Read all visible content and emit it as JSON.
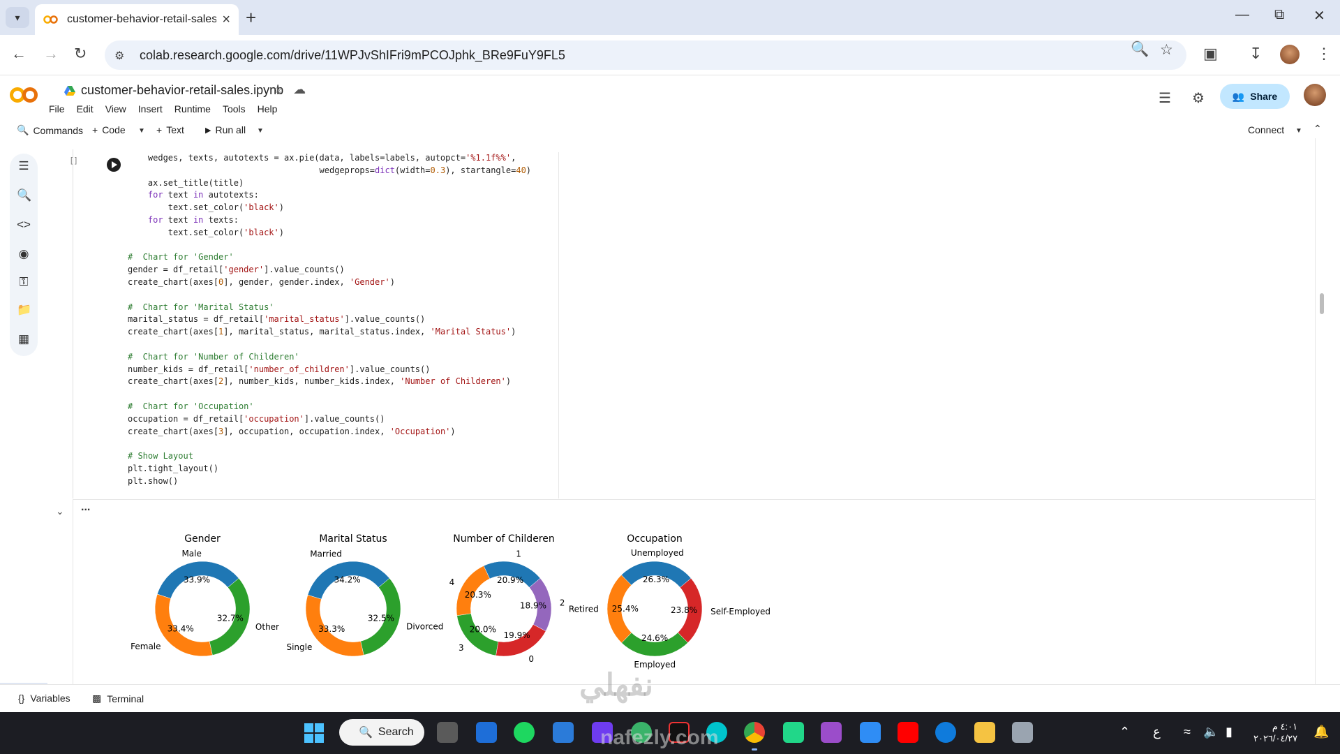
{
  "browser": {
    "tab_title": "customer-behavior-retail-sales.",
    "url": "colab.research.google.com/drive/11WPJvShIFri9mPCOJphk_BRe9FuY9FL5"
  },
  "colab": {
    "notebook_title": "customer-behavior-retail-sales.ipynb",
    "menu": [
      "File",
      "Edit",
      "View",
      "Insert",
      "Runtime",
      "Tools",
      "Help"
    ],
    "share_label": "Share",
    "toolbar": {
      "commands": "Commands",
      "code": "Code",
      "text": "Text",
      "run_all": "Run all",
      "connect": "Connect"
    }
  },
  "cell": {
    "bracket": "[ ]",
    "code_lines": [
      [
        [
          "",
          "    wedges, texts, autotexts = ax.pie(data, labels=labels, autopct="
        ],
        [
          "str",
          "'%1.1f%%'"
        ],
        [
          "",
          ","
        ]
      ],
      [
        [
          "",
          "                                      wedgeprops="
        ],
        [
          "kw",
          "dict"
        ],
        [
          "",
          "(width="
        ],
        [
          "num",
          "0.3"
        ],
        [
          "",
          "), startangle="
        ],
        [
          "num",
          "40"
        ],
        [
          "",
          ")"
        ]
      ],
      [
        [
          "",
          "    ax.set_title(title)"
        ]
      ],
      [
        [
          "kw",
          "    for"
        ],
        [
          "",
          " text "
        ],
        [
          "kw",
          "in"
        ],
        [
          "",
          " autotexts:"
        ]
      ],
      [
        [
          "",
          "        text.set_color("
        ],
        [
          "str",
          "'black'"
        ],
        [
          "",
          ")"
        ]
      ],
      [
        [
          "kw",
          "    for"
        ],
        [
          "",
          " text "
        ],
        [
          "kw",
          "in"
        ],
        [
          "",
          " texts:"
        ]
      ],
      [
        [
          "",
          "        text.set_color("
        ],
        [
          "str",
          "'black'"
        ],
        [
          "",
          ")"
        ]
      ],
      [
        [
          "",
          ""
        ]
      ],
      [
        [
          "cm",
          "#  Chart for 'Gender'"
        ]
      ],
      [
        [
          "",
          "gender = df_retail["
        ],
        [
          "str",
          "'gender'"
        ],
        [
          "",
          "].value_counts()"
        ]
      ],
      [
        [
          "",
          "create_chart(axes["
        ],
        [
          "num",
          "0"
        ],
        [
          "",
          "], gender, gender.index, "
        ],
        [
          "str",
          "'Gender'"
        ],
        [
          "",
          ")"
        ]
      ],
      [
        [
          "",
          ""
        ]
      ],
      [
        [
          "cm",
          "#  Chart for 'Marital Status'"
        ]
      ],
      [
        [
          "",
          "marital_status = df_retail["
        ],
        [
          "str",
          "'marital_status'"
        ],
        [
          "",
          "].value_counts()"
        ]
      ],
      [
        [
          "",
          "create_chart(axes["
        ],
        [
          "num",
          "1"
        ],
        [
          "",
          "], marital_status, marital_status.index, "
        ],
        [
          "str",
          "'Marital Status'"
        ],
        [
          "",
          ")"
        ]
      ],
      [
        [
          "",
          ""
        ]
      ],
      [
        [
          "cm",
          "#  Chart for 'Number of Childeren'"
        ]
      ],
      [
        [
          "",
          "number_kids = df_retail["
        ],
        [
          "str",
          "'number_of_children'"
        ],
        [
          "",
          "].value_counts()"
        ]
      ],
      [
        [
          "",
          "create_chart(axes["
        ],
        [
          "num",
          "2"
        ],
        [
          "",
          "], number_kids, number_kids.index, "
        ],
        [
          "str",
          "'Number of Childeren'"
        ],
        [
          "",
          ")"
        ]
      ],
      [
        [
          "",
          ""
        ]
      ],
      [
        [
          "cm",
          "#  Chart for 'Occupation'"
        ]
      ],
      [
        [
          "",
          "occupation = df_retail["
        ],
        [
          "str",
          "'occupation'"
        ],
        [
          "",
          "].value_counts()"
        ]
      ],
      [
        [
          "",
          "create_chart(axes["
        ],
        [
          "num",
          "3"
        ],
        [
          "",
          "], occupation, occupation.index, "
        ],
        [
          "str",
          "'Occupation'"
        ],
        [
          "",
          ")"
        ]
      ],
      [
        [
          "",
          ""
        ]
      ],
      [
        [
          "cm",
          "# Show Layout"
        ]
      ],
      [
        [
          "",
          "plt.tight_layout()"
        ]
      ],
      [
        [
          "",
          "plt.show()"
        ]
      ]
    ]
  },
  "output_menu": "...",
  "chart_data": [
    {
      "type": "pie",
      "title": "Gender",
      "donut": true,
      "labels": [
        "Male",
        "Female",
        "Other"
      ],
      "values": [
        33.9,
        33.4,
        32.7
      ],
      "value_labels": [
        "33.9%",
        "33.4%",
        "32.7%"
      ],
      "colors": [
        "#1f77b4",
        "#ff7f0e",
        "#2ca02c"
      ]
    },
    {
      "type": "pie",
      "title": "Marital Status",
      "donut": true,
      "labels": [
        "Married",
        "Single",
        "Divorced"
      ],
      "values": [
        34.2,
        33.3,
        32.5
      ],
      "value_labels": [
        "34.2%",
        "33.3%",
        "32.5%"
      ],
      "colors": [
        "#1f77b4",
        "#ff7f0e",
        "#2ca02c"
      ]
    },
    {
      "type": "pie",
      "title": "Number of Childeren",
      "donut": true,
      "labels": [
        "1",
        "4",
        "3",
        "0",
        "2"
      ],
      "values": [
        20.9,
        20.3,
        20.0,
        19.9,
        18.9
      ],
      "value_labels": [
        "20.9%",
        "20.3%",
        "20.0%",
        "19.9%",
        "18.9%"
      ],
      "colors": [
        "#1f77b4",
        "#ff7f0e",
        "#2ca02c",
        "#d62728",
        "#9467bd"
      ]
    },
    {
      "type": "pie",
      "title": "Occupation",
      "donut": true,
      "labels": [
        "Unemployed",
        "Retired",
        "Employed",
        "Self-Employed"
      ],
      "values": [
        26.3,
        25.4,
        24.6,
        23.8
      ],
      "value_labels": [
        "26.3%",
        "25.4%",
        "24.6%",
        "23.8%"
      ],
      "colors": [
        "#1f77b4",
        "#ff7f0e",
        "#2ca02c",
        "#d62728"
      ]
    }
  ],
  "status_bar": {
    "variables": "Variables",
    "terminal": "Terminal"
  },
  "taskbar": {
    "search": "Search",
    "clock_time": "٤:٠١ م",
    "clock_date": "٢٠٢٦/٠٤/٢٧",
    "lang": "ع"
  },
  "watermark": {
    "arabic": "نفهلي",
    "latin": "nafezly.com"
  }
}
